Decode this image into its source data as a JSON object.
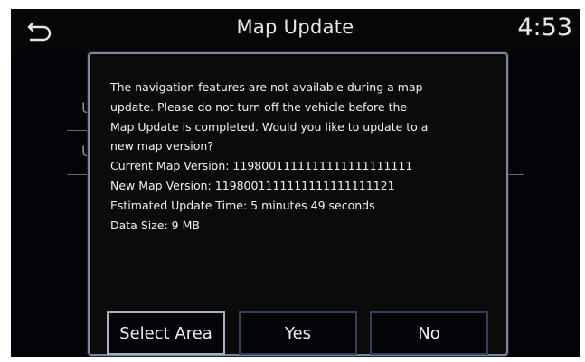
{
  "header": {
    "title": "Map Update",
    "clock": "4:53",
    "back_icon": "back-arrow-icon"
  },
  "background_list": {
    "item_initials": [
      "U",
      "U"
    ]
  },
  "dialog": {
    "message_lines": [
      "The navigation features are not available during a map",
      "update. Please do not turn off the vehicle before the",
      "Map Update is completed. Would you like to update to a",
      "new map version?"
    ],
    "current_version": "Current Map Version: 1198001111111111111111111",
    "new_version": "New Map Version: 1198001111111111111111121",
    "estimated_time": "Estimated Update Time: 5 minutes 49 seconds",
    "data_size": "Data Size: 9 MB",
    "buttons": {
      "select_area": "Select Area",
      "yes": "Yes",
      "no": "No"
    }
  },
  "colors": {
    "dialog_border": "#7c86a0",
    "button_border": "#343f5a",
    "focused_border": "#a9b0c2"
  }
}
